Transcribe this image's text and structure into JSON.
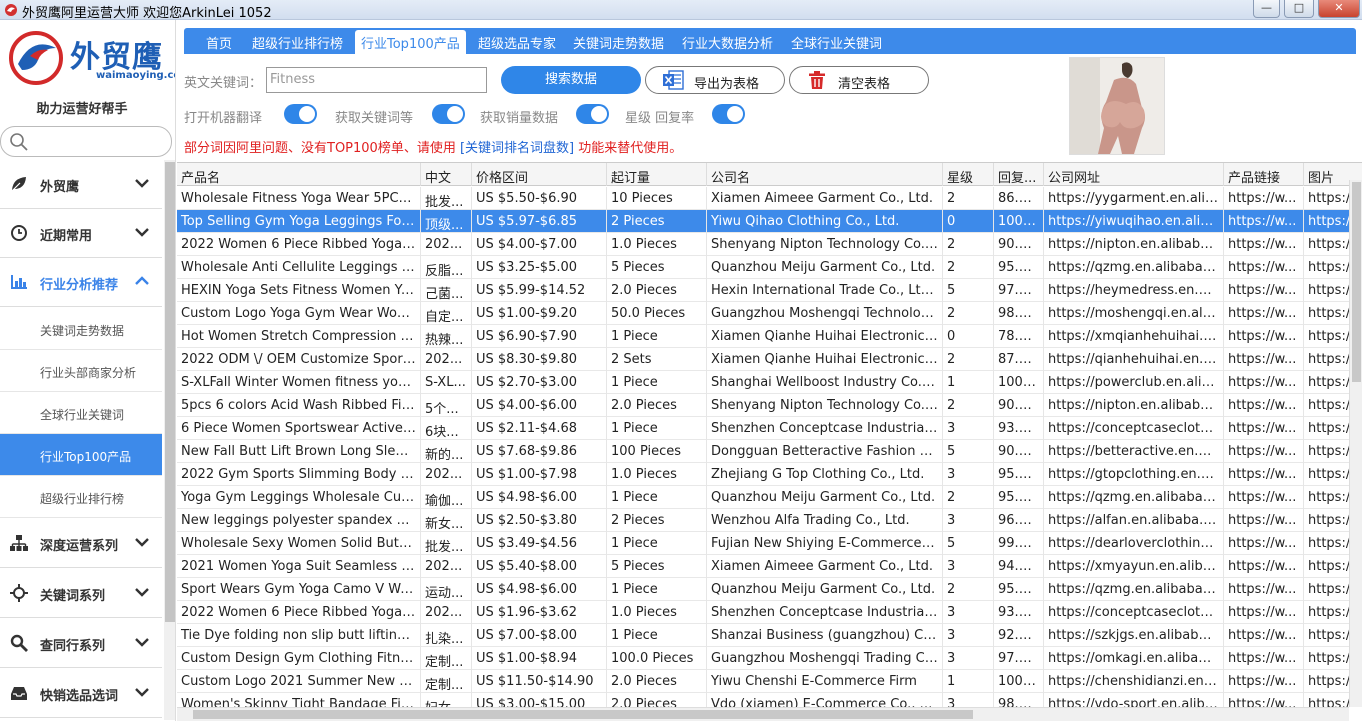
{
  "window": {
    "title": "外贸鹰阿里运营大师 欢迎您ArkinLei 1052",
    "min_label": "—",
    "max_label": "□",
    "close_label": "✕"
  },
  "sidebar": {
    "logo_cn": "外贸鹰",
    "logo_url": "waimaoying.com",
    "slogan": "助力运营好帮手",
    "search_placeholder": "",
    "groups": [
      {
        "label": "外贸鹰",
        "icon": "leaf-icon"
      },
      {
        "label": "近期常用",
        "icon": "clock-icon"
      },
      {
        "label": "行业分析推荐",
        "icon": "bar-chart-icon"
      },
      {
        "label": "深度运营系列",
        "icon": "org-chart-icon"
      },
      {
        "label": "关键词系列",
        "icon": "target-icon"
      },
      {
        "label": "查同行系列",
        "icon": "search-icon"
      },
      {
        "label": "快销选品选词",
        "icon": "inbox-icon"
      }
    ],
    "subitems": [
      "关键词走势数据",
      "行业头部商家分析",
      "全球行业关键词",
      "行业Top100产品",
      "超级行业排行榜"
    ]
  },
  "tabs": [
    "首页",
    "超级行业排行榜",
    "行业Top100产品",
    "超级选品专家",
    "关键词走势数据",
    "行业大数据分析",
    "全球行业关键词"
  ],
  "form": {
    "keyword_label": "英文关键词：",
    "keyword_value": "Fitness",
    "search_btn": "搜索数据",
    "export_btn": "导出为表格",
    "clear_btn": "清空表格",
    "toggles": [
      "打开机器翻译",
      "获取关键词等",
      "获取销量数据",
      "星级 回复率"
    ]
  },
  "notice": {
    "part1": "部分词因阿里问题、没有TOP100榜单、请使用 ",
    "link": "[关键词排名词盘数]",
    "part2": " 功能来替代使用。"
  },
  "colors": {
    "accent": "#3d8aea",
    "notice": "#e02020",
    "link": "#2166d4"
  },
  "table": {
    "columns": [
      "产品名",
      "中文",
      "价格区间",
      "起订量",
      "公司名",
      "星级",
      "回复...",
      "公司网址",
      "产品链接",
      "图片"
    ],
    "selected_row": 1,
    "rows": [
      [
        "Wholesale Fitness Yoga Wear 5PCS ...",
        "批发...",
        "US $5.50-$6.90",
        "10 Pieces",
        "Xiamen Aimeee Garment Co., Ltd.",
        "2",
        "86.3...",
        "https://yygarment.en.alib...",
        "https://w...",
        "https:/"
      ],
      [
        "Top Selling Gym Yoga Leggings For ...",
        "顶级...",
        "US $5.97-$6.85",
        "2 Pieces",
        "Yiwu Qihao Clothing Co., Ltd.",
        "0",
        "100....",
        "https://yiwuqihao.en.aliba...",
        "https://w...",
        "https:/"
      ],
      [
        "2022 Women 6 Piece Ribbed Yoga S...",
        "202...",
        "US $4.00-$7.00",
        "1.0 Pieces",
        "Shenyang Nipton Technology Co., ...",
        "2",
        "90.7...",
        "https://nipton.en.alibaba....",
        "https://w...",
        "https:/"
      ],
      [
        "Wholesale Anti Cellulite Leggings Wo...",
        "反脂...",
        "US $3.25-$5.00",
        "5 Pieces",
        "Quanzhou Meiju Garment Co., Ltd.",
        "2",
        "95.6...",
        "https://qzmg.en.alibaba.c...",
        "https://w...",
        "https:/"
      ],
      [
        "HEXIN Yoga Sets Fitness Women Yo...",
        "己菌...",
        "US $5.99-$14.52",
        "2.0 Pieces",
        "Hexin International Trade Co., Ltd. ...",
        "5",
        "97.3...",
        "https://heymedress.en.ali...",
        "https://w...",
        "https:/"
      ],
      [
        "Custom Logo Yoga Gym Wear Wom...",
        "自定...",
        "US $1.00-$9.20",
        "50.0 Pieces",
        "Guangzhou Moshengqi Technolog...",
        "2",
        "98.3...",
        "https://moshengqi.en.alib...",
        "https://w...",
        "https:/"
      ],
      [
        "Hot Women Stretch Compression C...",
        "热辣...",
        "US $6.90-$7.90",
        "1 Piece",
        "Xiamen Qianhe Huihai Electronic C...",
        "0",
        "78.3...",
        "https://xmqianhehuihai.e...",
        "https://w...",
        "https:/"
      ],
      [
        "2022 ODM \\/ OEM Customize Sport...",
        "202...",
        "US $8.30-$9.80",
        "2 Sets",
        "Xiamen Qianhe Huihai Electronic C...",
        "2",
        "87.9...",
        "https://qianhehuihai.en.ali...",
        "https://w...",
        "https:/"
      ],
      [
        "S-XLFall Winter Women fitness yoga...",
        "S-XL...",
        "US $2.70-$3.00",
        "1 Piece",
        "Shanghai Wellboost Industry Co., L...",
        "1",
        "100....",
        "https://powerclub.en.alib...",
        "https://w...",
        "https:/"
      ],
      [
        "5pcs 6 colors Acid Wash Ribbed Fitn...",
        "5个...",
        "US $4.00-$6.00",
        "2.0 Pieces",
        "Shenyang Nipton Technology Co., ...",
        "2",
        "90.7...",
        "https://nipton.en.alibaba....",
        "https://w...",
        "https:/"
      ],
      [
        "6 Piece Women Sportswear Active Fi...",
        "6块...",
        "US $2.11-$4.68",
        "1 Piece",
        "Shenzhen Conceptcase Industrial ...",
        "3",
        "93.4...",
        "https://conceptcaseclothi...",
        "https://w...",
        "https:/"
      ],
      [
        "New Fall Butt Lift Brown Long Sleeve...",
        "新的...",
        "US $7.68-$9.86",
        "100 Pieces",
        "Dongguan Betteractive Fashion Co...",
        "5",
        "90.2...",
        "https://betteractive.en.ali...",
        "https://w...",
        "https:/"
      ],
      [
        "2022 Gym Sports Slimming Body Sh...",
        "202...",
        "US $1.00-$7.98",
        "1.0 Pieces",
        "Zhejiang G Top Clothing Co., Ltd.",
        "3",
        "95.2...",
        "https://gtopclothing.en.al...",
        "https://w...",
        "https:/"
      ],
      [
        "Yoga Gym Leggings Wholesale Cust...",
        "瑜伽...",
        "US $4.98-$6.00",
        "1 Piece",
        "Quanzhou Meiju Garment Co., Ltd.",
        "2",
        "95.6...",
        "https://qzmg.en.alibaba.c...",
        "https://w...",
        "https:/"
      ],
      [
        "New leggings polyester spandex fitn...",
        "新女...",
        "US $2.50-$3.80",
        "2 Pieces",
        "Wenzhou Alfa Trading Co., Ltd.",
        "3",
        "96.7...",
        "https://alfan.en.alibaba.co...",
        "https://w...",
        "https:/"
      ],
      [
        "Wholesale Sexy Women Solid Butt Li...",
        "批发...",
        "US $3.49-$4.56",
        "1 Piece",
        "Fujian New Shiying E-Commerce C...",
        "5",
        "99.6...",
        "https://dearloverclothing....",
        "https://w...",
        "https:/"
      ],
      [
        "2021 Women Yoga Suit Seamless Lo...",
        "202...",
        "US $5.40-$8.00",
        "5 Pieces",
        "Xiamen Aimeee Garment Co., Ltd.",
        "3",
        "94.4...",
        "https://xmyayun.en.aliba...",
        "https://w...",
        "https:/"
      ],
      [
        "Sport Wears Gym Yoga Camo V Wai...",
        "运动...",
        "US $4.98-$6.00",
        "1 Piece",
        "Quanzhou Meiju Garment Co., Ltd.",
        "2",
        "95.6...",
        "https://qzmg.en.alibaba.c...",
        "https://w...",
        "https:/"
      ],
      [
        "2022 Women 6 Piece Ribbed Yoga S...",
        "202...",
        "US $1.96-$3.62",
        "1.0 Pieces",
        "Shenzhen Conceptcase Industrial ...",
        "3",
        "93.4...",
        "https://conceptcaseclothi...",
        "https://w...",
        "https:/"
      ],
      [
        "Tie Dye folding non slip butt lifting h...",
        "扎染...",
        "US $7.00-$8.00",
        "1 Piece",
        "Shanzai Business (guangzhou) Co., ...",
        "3",
        "92.3...",
        "https://szkjgs.en.alibaba.c...",
        "https://w...",
        "https:/"
      ],
      [
        "Custom Design Gym Clothing Fitnes...",
        "定制...",
        "US $1.00-$8.94",
        "100.0 Pieces",
        "Guangzhou Moshengqi Trading Co...",
        "3",
        "97.6...",
        "https://omkagi.en.alibaba....",
        "https://w...",
        "https:/"
      ],
      [
        "Custom Logo 2021 Summer New Lis...",
        "定制...",
        "US $11.50-$14.90",
        "2.0 Pieces",
        "Yiwu Chenshi E-Commerce Firm",
        "1",
        "100....",
        "https://chenshidianzi.en.a...",
        "https://w...",
        "https:/"
      ],
      [
        "Women's Skinny Tight Bandage Fitn...",
        "妇女...",
        "US $3.00-$15.00",
        "2.0 Pieces",
        "Vdo (xiamen) E-Commerce Co., Ltd...",
        "3",
        "98.7...",
        "https://vdo-sport.en.aliba...",
        "https://w...",
        "https:/"
      ]
    ]
  }
}
